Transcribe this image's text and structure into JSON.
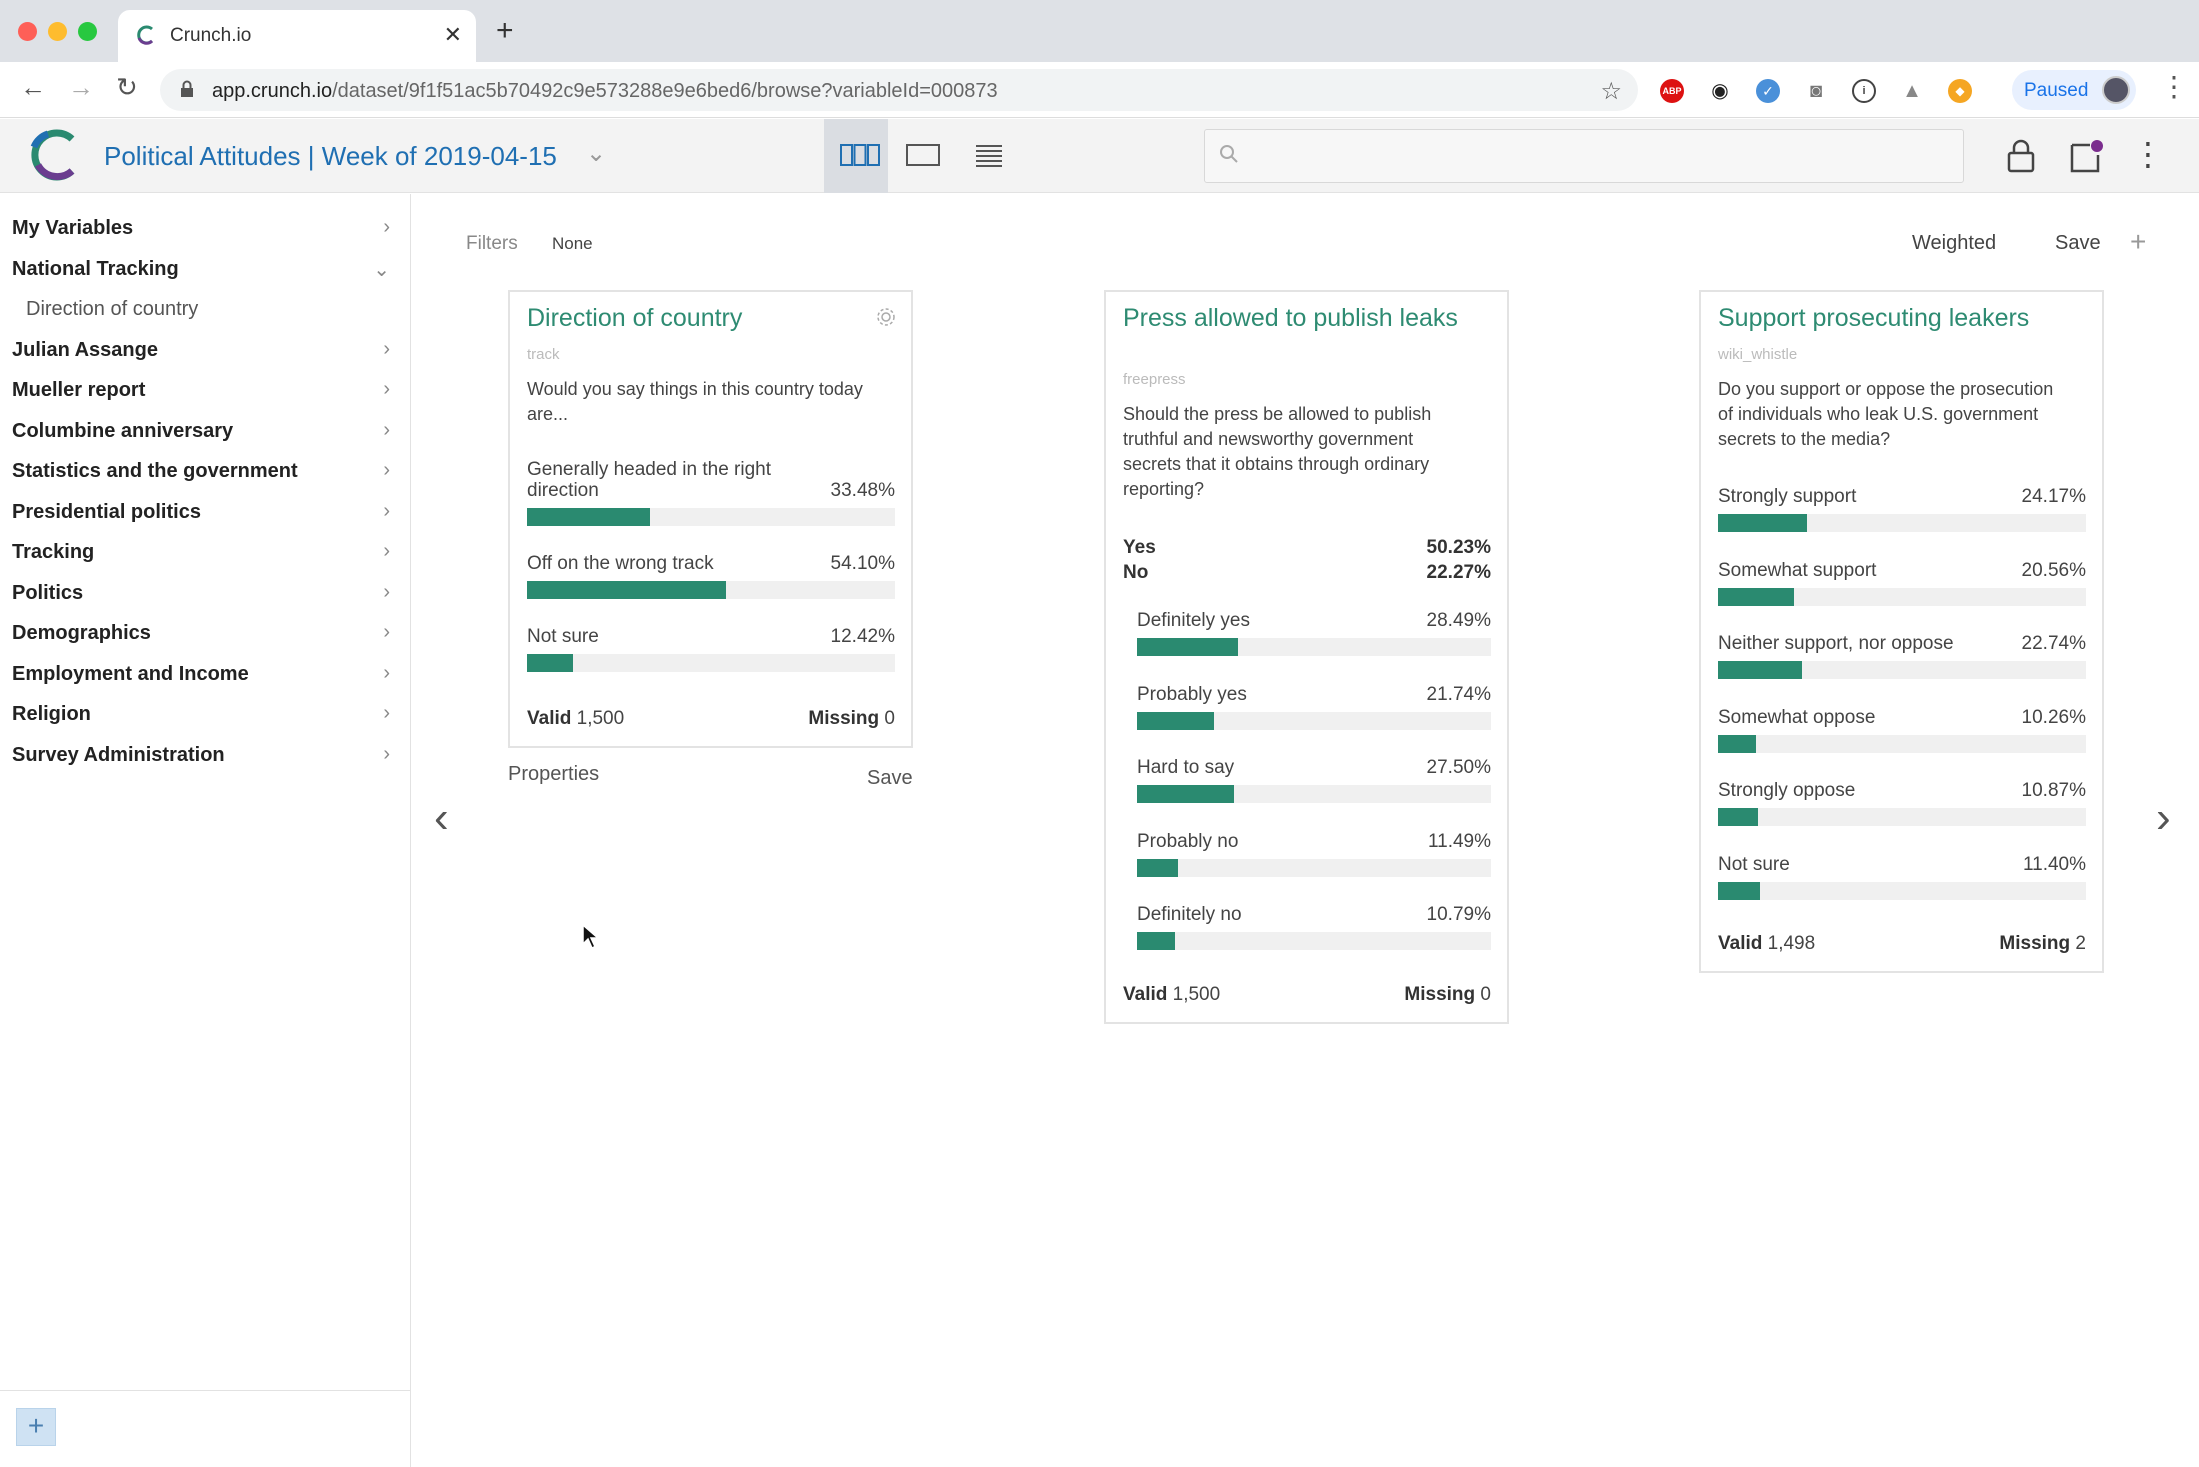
{
  "browser": {
    "tab_title": "Crunch.io",
    "url_host": "app.crunch.io",
    "url_path": "/dataset/9f1f51ac5b70492c9e573288e9e6bed6/browse?variableId=000873",
    "paused_label": "Paused",
    "ext_abp": "ABP"
  },
  "header": {
    "dataset_title": "Political Attitudes | Week of 2019-04-15",
    "search_placeholder": ""
  },
  "sidebar": {
    "items": [
      {
        "label": "My Variables",
        "chev": "›"
      },
      {
        "label": "National Tracking",
        "chev": "⌄"
      },
      {
        "label": "Direction of country",
        "chev": ""
      },
      {
        "label": "Julian Assange",
        "chev": "›"
      },
      {
        "label": "Mueller report",
        "chev": "›"
      },
      {
        "label": "Columbine anniversary",
        "chev": "›"
      },
      {
        "label": "Statistics and the government",
        "chev": "›"
      },
      {
        "label": "Presidential politics",
        "chev": "›"
      },
      {
        "label": "Tracking",
        "chev": "›"
      },
      {
        "label": "Politics",
        "chev": "›"
      },
      {
        "label": "Demographics",
        "chev": "›"
      },
      {
        "label": "Employment and Income",
        "chev": "›"
      },
      {
        "label": "Religion",
        "chev": "›"
      },
      {
        "label": "Survey Administration",
        "chev": "›"
      }
    ],
    "add_label": "+"
  },
  "main": {
    "filters_label": "Filters",
    "filters_value": "None",
    "weighted_label": "Weighted",
    "save_label": "Save",
    "add_label": "+",
    "prev_arrow": "‹",
    "next_arrow": "›",
    "properties_label": "Properties",
    "card_save_label": "Save"
  },
  "cards": [
    {
      "title": "Direction of country",
      "alias": "track",
      "question": "Would you say things in this country today are...",
      "categories": [
        {
          "label": "Generally headed in the right direction",
          "pct": "33.48%",
          "value": 33.48
        },
        {
          "label": "Off on the wrong track",
          "pct": "54.10%",
          "value": 54.1
        },
        {
          "label": "Not sure",
          "pct": "12.42%",
          "value": 12.42
        }
      ],
      "valid_label": "Valid",
      "valid": "1,500",
      "missing_label": "Missing",
      "missing": "0"
    },
    {
      "title": "Press allowed to publish leaks",
      "alias": "freepress",
      "question": "Should the press be allowed to publish truthful and newsworthy government secrets that it obtains through ordinary reporting?",
      "nets": [
        {
          "label": "Yes",
          "pct": "50.23%"
        },
        {
          "label": "No",
          "pct": "22.27%"
        }
      ],
      "categories": [
        {
          "label": "Definitely yes",
          "pct": "28.49%",
          "value": 28.49
        },
        {
          "label": "Probably yes",
          "pct": "21.74%",
          "value": 21.74
        },
        {
          "label": "Hard to say",
          "pct": "27.50%",
          "value": 27.5
        },
        {
          "label": "Probably no",
          "pct": "11.49%",
          "value": 11.49
        },
        {
          "label": "Definitely no",
          "pct": "10.79%",
          "value": 10.79
        }
      ],
      "valid_label": "Valid",
      "valid": "1,500",
      "missing_label": "Missing",
      "missing": "0"
    },
    {
      "title": "Support prosecuting leakers",
      "alias": "wiki_whistle",
      "question": "Do you support or oppose the prosecution of individuals who leak U.S. government secrets to the media?",
      "categories": [
        {
          "label": "Strongly support",
          "pct": "24.17%",
          "value": 24.17
        },
        {
          "label": "Somewhat support",
          "pct": "20.56%",
          "value": 20.56
        },
        {
          "label": "Neither support, nor oppose",
          "pct": "22.74%",
          "value": 22.74
        },
        {
          "label": "Somewhat oppose",
          "pct": "10.26%",
          "value": 10.26
        },
        {
          "label": "Strongly oppose",
          "pct": "10.87%",
          "value": 10.87
        },
        {
          "label": "Not sure",
          "pct": "11.40%",
          "value": 11.4
        }
      ],
      "valid_label": "Valid",
      "valid": "1,498",
      "missing_label": "Missing",
      "missing": "2"
    }
  ],
  "colors": {
    "accent": "#2a8a70",
    "title_blue": "#1f6fb2",
    "bar_track": "#f0f0f0"
  }
}
